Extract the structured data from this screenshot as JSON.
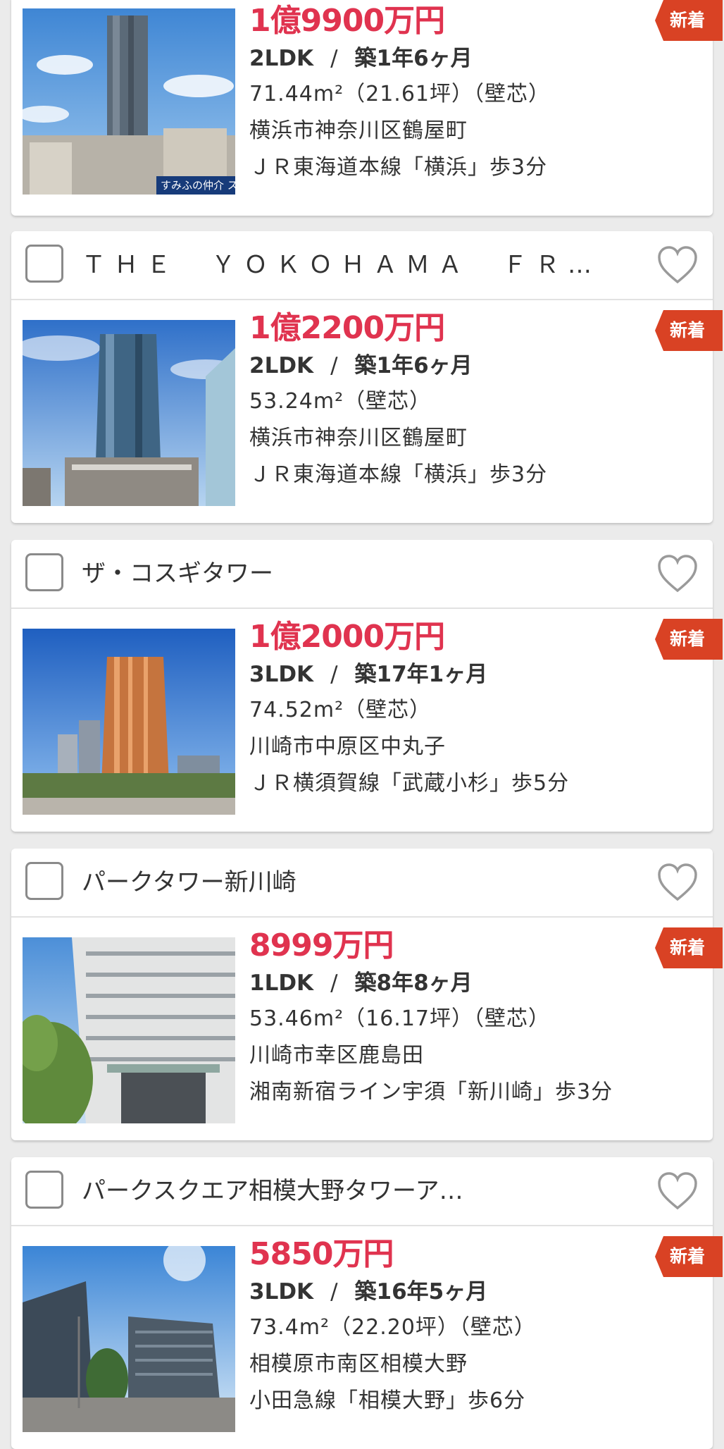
{
  "badge_label": "新着",
  "colors": {
    "price": "#e0334f",
    "badge": "#d94224"
  },
  "listings": [
    {
      "name": "",
      "price": "1億9900万円",
      "layout": "2LDK",
      "separator": "/",
      "age": "築1年6ヶ月",
      "area": "71.44m²（21.61坪）（壁芯）",
      "address": "横浜市神奈川区鶴屋町",
      "access": "ＪＲ東海道本線「横浜」歩3分",
      "photo_caption": "すみふの仲介 ス"
    },
    {
      "name": "ＴＨＥ　ＹＯＫＯＨＡＭＡ　ＦＲ…",
      "price": "1億2200万円",
      "layout": "2LDK",
      "separator": "/",
      "age": "築1年6ヶ月",
      "area": "53.24m²（壁芯）",
      "address": "横浜市神奈川区鶴屋町",
      "access": "ＪＲ東海道本線「横浜」歩3分"
    },
    {
      "name": "ザ・コスギタワー",
      "price": "1億2000万円",
      "layout": "3LDK",
      "separator": "/",
      "age": "築17年1ヶ月",
      "area": "74.52m²（壁芯）",
      "address": "川崎市中原区中丸子",
      "access": "ＪＲ横須賀線「武蔵小杉」歩5分"
    },
    {
      "name": "パークタワー新川崎",
      "price": "8999万円",
      "layout": "1LDK",
      "separator": "/",
      "age": "築8年8ヶ月",
      "area": "53.46m²（16.17坪）（壁芯）",
      "address": "川崎市幸区鹿島田",
      "access": "湘南新宿ライン宇須「新川崎」歩3分"
    },
    {
      "name": "パークスクエア相模大野タワーア…",
      "price": "5850万円",
      "layout": "3LDK",
      "separator": "/",
      "age": "築16年5ヶ月",
      "area": "73.4m²（22.20坪）（壁芯）",
      "address": "相模原市南区相模大野",
      "access": "小田急線「相模大野」歩6分"
    }
  ]
}
